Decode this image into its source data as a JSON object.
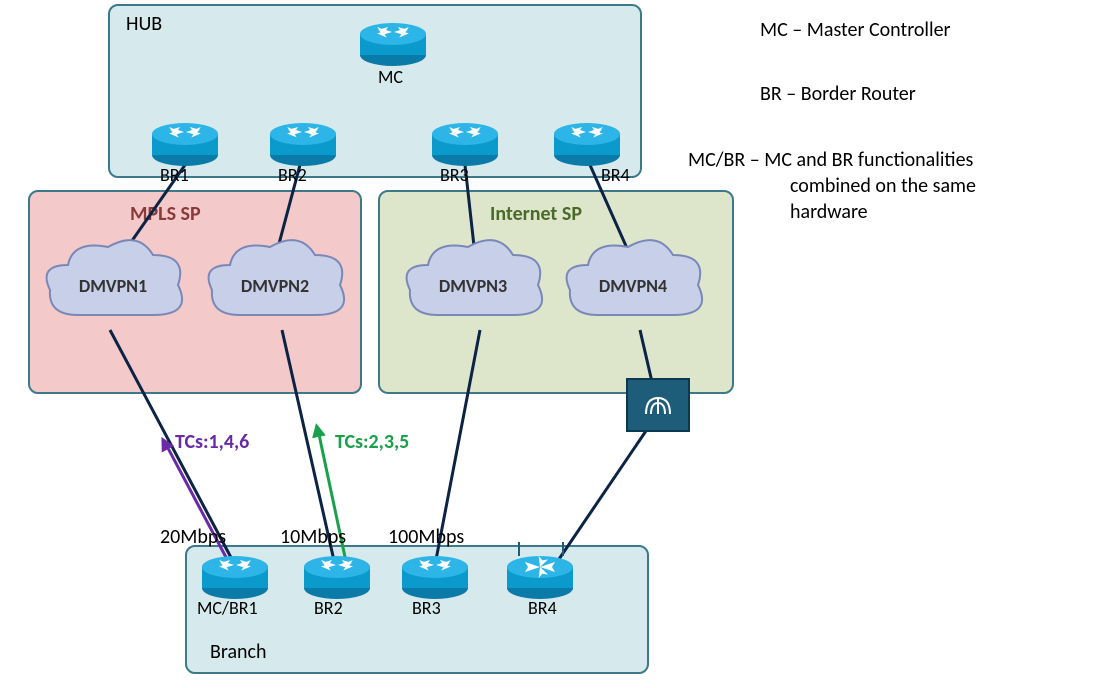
{
  "legend": {
    "mc": "MC – Master Controller",
    "br": "BR – Border Router",
    "mcbr1": "MC/BR – MC and BR functionalities",
    "mcbr2": "combined on the same",
    "mcbr3": "hardware"
  },
  "zones": {
    "hub": "HUB",
    "mpls": "MPLS SP",
    "inet": "Internet SP",
    "branch": "Branch"
  },
  "clouds": {
    "d1": "DMVPN1",
    "d2": "DMVPN2",
    "d3": "DMVPN3",
    "d4": "DMVPN4"
  },
  "routers": {
    "mc": "MC",
    "hbr1": "BR1",
    "hbr2": "BR2",
    "hbr3": "BR3",
    "hbr4": "BR4",
    "bbr1": "MC/BR1",
    "bbr2": "BR2",
    "bbr3": "BR3",
    "bbr4": "BR4"
  },
  "bandwidth": {
    "b1": "20Mbps",
    "b2": "10Mbps",
    "b3": "100Mbps"
  },
  "tc": {
    "t1": "TCs:1,4,6",
    "t2": "TCs:2,3,5"
  }
}
